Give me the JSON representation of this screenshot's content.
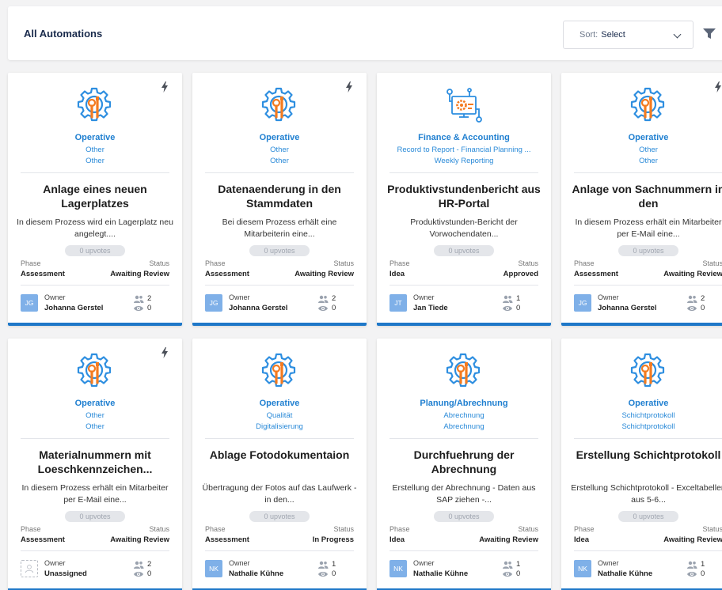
{
  "header": {
    "title": "All Automations",
    "sort_label": "Sort:",
    "sort_value": "Select"
  },
  "colors": {
    "accent": "#1f78c8",
    "category_text": "#1f7fd0",
    "icon_orange": "#f47b20",
    "icon_blue": "#2d8ee0"
  },
  "cards": [
    {
      "icon": "gear-wrench-icon",
      "bolt": true,
      "category": "Operative",
      "sub1": "Other",
      "sub2": "Other",
      "title": "Anlage eines neuen Lagerplatzes",
      "description": "In diesem Prozess wird ein Lagerplatz neu angelegt....",
      "upvotes": "0 upvotes",
      "phase_label": "Phase",
      "status_label": "Status",
      "phase": "Assessment",
      "status": "Awaiting Review",
      "owner_label": "Owner",
      "owner_initials": "JG",
      "owner_name": "Johanna Gerstel",
      "members": "2",
      "views": "0"
    },
    {
      "icon": "gear-wrench-icon",
      "bolt": true,
      "category": "Operative",
      "sub1": "Other",
      "sub2": "Other",
      "title": "Datenaenderung in den Stammdaten",
      "description": "Bei diesem Prozess erhält eine Mitarbeiterin eine...",
      "upvotes": "0 upvotes",
      "phase_label": "Phase",
      "status_label": "Status",
      "phase": "Assessment",
      "status": "Awaiting Review",
      "owner_label": "Owner",
      "owner_initials": "JG",
      "owner_name": "Johanna Gerstel",
      "members": "2",
      "views": "0"
    },
    {
      "icon": "finance-computer-icon",
      "bolt": false,
      "category": "Finance & Accounting",
      "sub1": "Record to Report - Financial Planning ...",
      "sub2": "Weekly Reporting",
      "title": "Produktivstundenbericht aus HR-Portal",
      "description": "Produktivstunden-Bericht der Vorwochendaten...",
      "upvotes": "0 upvotes",
      "phase_label": "Phase",
      "status_label": "Status",
      "phase": "Idea",
      "status": "Approved",
      "owner_label": "Owner",
      "owner_initials": "JT",
      "owner_name": "Jan Tiede",
      "members": "1",
      "views": "0"
    },
    {
      "icon": "gear-wrench-icon",
      "bolt": true,
      "category": "Operative",
      "sub1": "Other",
      "sub2": "Other",
      "title": "Anlage von Sachnummern in den",
      "description": "In diesem Prozess erhält ein Mitarbeiter per E-Mail eine...",
      "upvotes": "0 upvotes",
      "phase_label": "Phase",
      "status_label": "Status",
      "phase": "Assessment",
      "status": "Awaiting Review",
      "owner_label": "Owner",
      "owner_initials": "JG",
      "owner_name": "Johanna Gerstel",
      "members": "2",
      "views": "0"
    },
    {
      "icon": "gear-wrench-icon",
      "bolt": true,
      "category": "Operative",
      "sub1": "Other",
      "sub2": "Other",
      "title": "Materialnummern mit Loeschkennzeichen...",
      "description": "In diesem Prozess erhält ein Mitarbeiter per E-Mail eine...",
      "upvotes": "0 upvotes",
      "phase_label": "Phase",
      "status_label": "Status",
      "phase": "Assessment",
      "status": "Awaiting Review",
      "owner_label": "Owner",
      "owner_initials": "",
      "owner_name": "Unassigned",
      "members": "2",
      "views": "0"
    },
    {
      "icon": "gear-wrench-icon",
      "bolt": false,
      "category": "Operative",
      "sub1": "Qualität",
      "sub2": "Digitalisierung",
      "title": "Ablage Fotodokumentaion",
      "description": "Übertragung der Fotos auf das Laufwerk - in den...",
      "upvotes": "0 upvotes",
      "phase_label": "Phase",
      "status_label": "Status",
      "phase": "Assessment",
      "status": "In Progress",
      "owner_label": "Owner",
      "owner_initials": "NK",
      "owner_name": "Nathalie Kühne",
      "members": "1",
      "views": "0"
    },
    {
      "icon": "gear-wrench-icon",
      "bolt": false,
      "category": "Planung/Abrechnung",
      "sub1": "Abrechnung",
      "sub2": "Abrechnung",
      "title": "Durchfuehrung der Abrechnung",
      "description": "Erstellung der Abrechnung - Daten aus SAP ziehen -...",
      "upvotes": "0 upvotes",
      "phase_label": "Phase",
      "status_label": "Status",
      "phase": "Idea",
      "status": "Awaiting Review",
      "owner_label": "Owner",
      "owner_initials": "NK",
      "owner_name": "Nathalie Kühne",
      "members": "1",
      "views": "0"
    },
    {
      "icon": "gear-wrench-icon",
      "bolt": false,
      "category": "Operative",
      "sub1": "Schichtprotokoll",
      "sub2": "Schichtprotokoll",
      "title": "Erstellung Schichtprotokoll",
      "description": "Erstellung Schichtprotokoll - Exceltabellen aus 5-6...",
      "upvotes": "0 upvotes",
      "phase_label": "Phase",
      "status_label": "Status",
      "phase": "Idea",
      "status": "Awaiting Review",
      "owner_label": "Owner",
      "owner_initials": "NK",
      "owner_name": "Nathalie Kühne",
      "members": "1",
      "views": "0"
    }
  ]
}
